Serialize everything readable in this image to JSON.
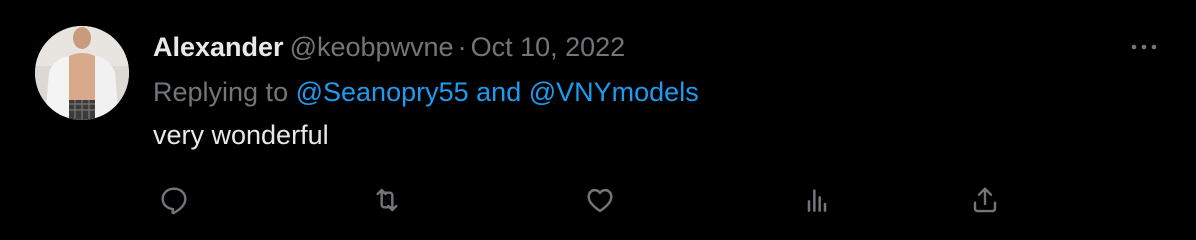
{
  "tweet": {
    "author_name": "Alexander",
    "author_handle": "@keobpwvne",
    "separator": "·",
    "date": "Oct 10, 2022",
    "replying_prefix": "Replying to",
    "replying_to": [
      "@Seanopry55",
      "@VNYmodels"
    ],
    "replying_conjunction": "and",
    "text": "very wonderful"
  },
  "icons": {
    "more": "more-icon",
    "reply": "reply-icon",
    "retweet": "retweet-icon",
    "like": "heart-icon",
    "views": "analytics-icon",
    "share": "share-icon"
  },
  "colors": {
    "background": "#000000",
    "primary_text": "#e7e9ea",
    "secondary_text": "#71767b",
    "accent": "#1d9bf0"
  }
}
